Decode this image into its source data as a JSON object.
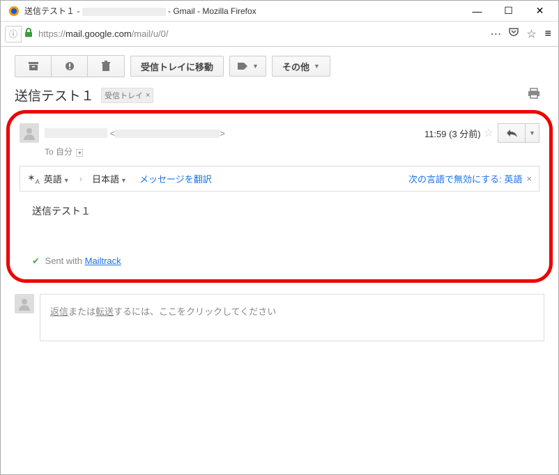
{
  "window": {
    "title_prefix": "送信テスト１ - ",
    "title_suffix": " - Gmail - Mozilla Firefox"
  },
  "urlbar": {
    "protocol": "https://",
    "host": "mail.google.com",
    "path": "/mail/u/0/"
  },
  "toolbar": {
    "move_to_inbox": "受信トレイに移動",
    "other": "その他"
  },
  "subject": "送信テスト１",
  "label": {
    "name": "受信トレイ",
    "close": "×"
  },
  "sender": {
    "angle_open": "<",
    "angle_close": ">",
    "to_prefix": "To ",
    "to_value": "自分"
  },
  "meta": {
    "time": "11:59",
    "age": "(3 分前)"
  },
  "translate": {
    "from_lang": "英語",
    "to_lang": "日本語",
    "action": "メッセージを翻訳",
    "disable_prefix": "次の言語で無効にする: ",
    "disable_lang": "英語"
  },
  "body": "送信テスト１",
  "mailtrack": {
    "prefix": "Sent with ",
    "name": "Mailtrack"
  },
  "reply": {
    "text_a": "返信",
    "text_b": "または",
    "text_c": "転送",
    "text_d": "するには、ここをクリックしてください"
  }
}
